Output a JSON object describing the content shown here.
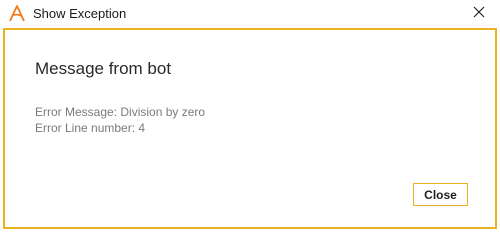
{
  "window": {
    "title": "Show Exception",
    "app_icon": "orange-a-logo-icon",
    "close_icon": "close-icon",
    "accent_color": "#e9b323"
  },
  "dialog": {
    "heading": "Message from bot",
    "error_message": "Error Message: Division by zero",
    "error_line": "Error Line number: 4",
    "close_label": "Close"
  }
}
